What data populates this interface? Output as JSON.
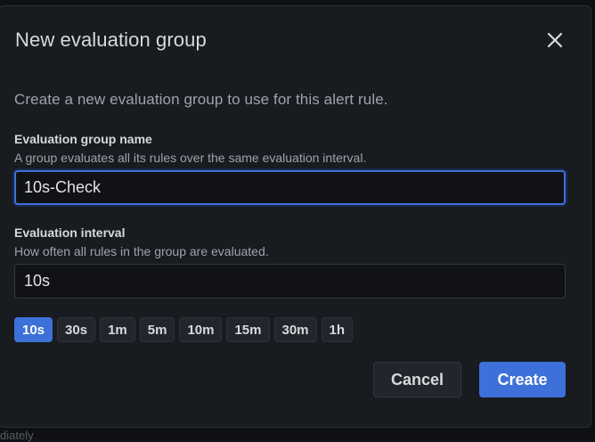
{
  "background": {
    "partial_text": "diately"
  },
  "modal": {
    "title": "New evaluation group",
    "close_icon": "close-icon",
    "description": "Create a new evaluation group to use for this alert rule.",
    "group_name": {
      "label": "Evaluation group name",
      "help": "A group evaluates all its rules over the same evaluation interval.",
      "value": "10s-Check"
    },
    "interval": {
      "label": "Evaluation interval",
      "help": "How often all rules in the group are evaluated.",
      "value": "10s",
      "options": [
        "10s",
        "30s",
        "1m",
        "5m",
        "10m",
        "15m",
        "30m",
        "1h"
      ],
      "selected": "10s"
    },
    "buttons": {
      "cancel": "Cancel",
      "create": "Create"
    }
  },
  "colors": {
    "accent": "#3d71d9",
    "modal_bg": "#181b1f",
    "input_bg": "#111217",
    "text_primary": "#d8d9dd",
    "text_secondary": "#9fa3ab"
  }
}
